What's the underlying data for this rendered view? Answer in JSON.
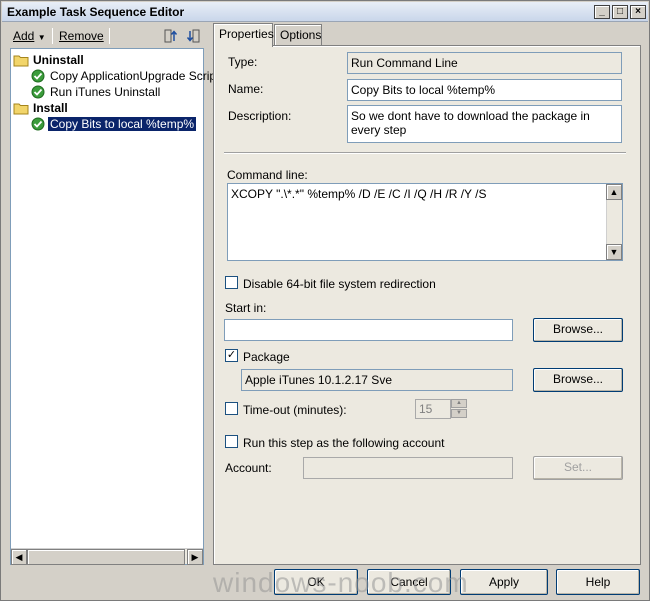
{
  "window": {
    "title": "Example Task Sequence Editor"
  },
  "toolbar": {
    "add_label": "Add",
    "remove_label": "Remove"
  },
  "tree": {
    "groups": [
      {
        "label": "Uninstall",
        "items": [
          "Copy ApplicationUpgrade Script",
          "Run iTunes Uninstall"
        ]
      },
      {
        "label": "Install",
        "items": [
          "Copy Bits to local %temp%"
        ]
      }
    ]
  },
  "tabs": [
    {
      "label": "Properties"
    },
    {
      "label": "Options"
    }
  ],
  "form": {
    "type_label": "Type:",
    "type_value": "Run Command Line",
    "name_label": "Name:",
    "name_value": "Copy Bits to local %temp%",
    "description_label": "Description:",
    "description_value": "So we dont have to download the package in every step",
    "command_line_label": "Command line:",
    "command_line_value": "XCOPY \".\\*.*\" %temp% /D /E /C /I /Q /H /R /Y /S",
    "disable_64bit_label": "Disable 64-bit file system redirection",
    "disable_64bit_checked": false,
    "start_in_label": "Start in:",
    "start_in_value": "",
    "browse_label": "Browse...",
    "package_label": "Package",
    "package_checked": true,
    "package_value": "Apple iTunes 10.1.2.17 Sve",
    "timeout_label": "Time-out (minutes):",
    "timeout_checked": false,
    "timeout_value": "15",
    "run_as_label": "Run this step as the following account",
    "run_as_checked": false,
    "account_label": "Account:",
    "account_value": "",
    "set_label": "Set..."
  },
  "footer": {
    "ok_label": "OK",
    "cancel_label": "Cancel",
    "apply_label": "Apply",
    "help_label": "Help"
  },
  "watermark": "windows-noob.com"
}
